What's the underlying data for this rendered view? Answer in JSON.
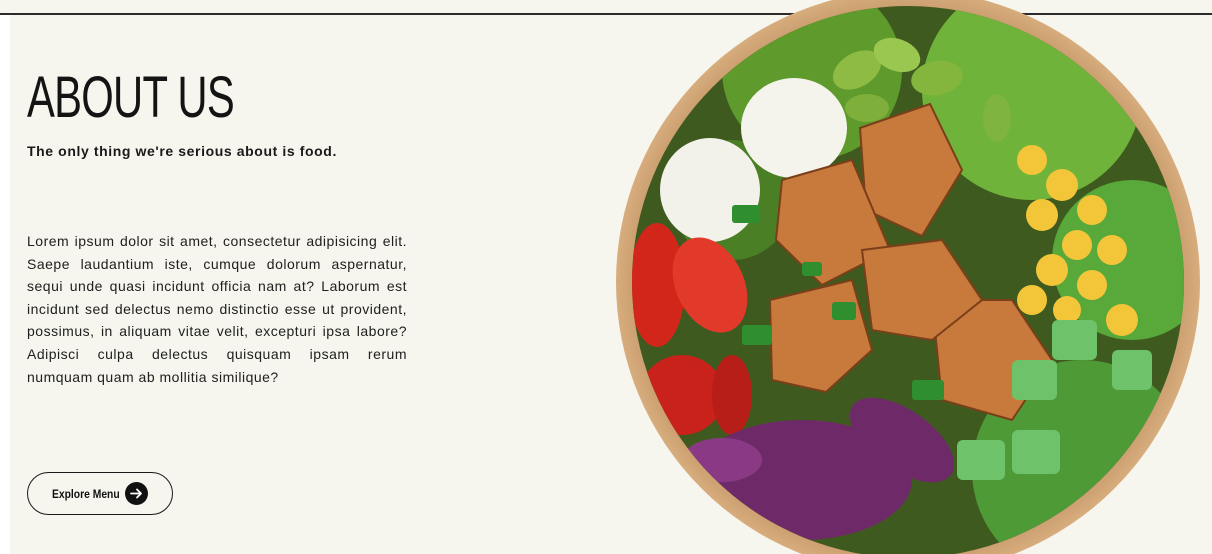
{
  "about": {
    "title": "ABOUT US",
    "tagline": "The only thing we're serious about is food.",
    "body": "Lorem ipsum dolor sit amet, consectetur adipisicing elit. Saepe laudantium iste, cumque dolorum aspernatur, sequi unde quasi incidunt officia nam at? Laborum est incidunt sed delectus nemo distinctio esse ut provident, possimus, in aliquam vitae velit, excepturi ipsa labore? Adipisci culpa delectus quisquam ipsam rerum numquam quam ab mollitia similique?",
    "cta_label": "Explore Menu",
    "cta_icon": "arrow-right-icon"
  },
  "image": {
    "alt": "bowl-of-salad-image"
  },
  "colors": {
    "background": "#f6f6ee",
    "text": "#141414",
    "bowl_rim": "#c79566"
  }
}
